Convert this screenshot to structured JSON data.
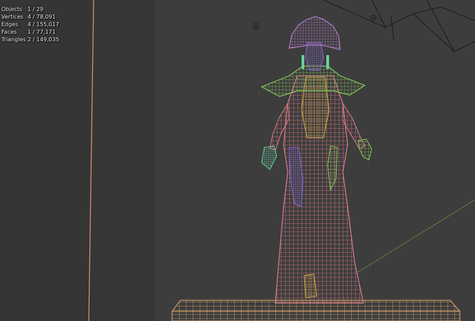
{
  "viewport": {
    "stats": [
      {
        "label": "Objects",
        "value": "1 / 29"
      },
      {
        "label": "Vertices",
        "value": "4 / 78,091"
      },
      {
        "label": "Edges",
        "value": "4 / 155,017"
      },
      {
        "label": "Faces",
        "value": "1 / 77,171"
      },
      {
        "label": "Triangles",
        "value": "2 / 149,035"
      }
    ]
  },
  "colors": {
    "background": "#3d3d3d",
    "side_panel": "#333333",
    "grid_line": "#393939",
    "x_axis": "#e8957e",
    "headdress": "#b27ac8",
    "face": "#8a6ad8",
    "dress": "#e07a88",
    "collar": "#8ac85a",
    "bodice": "#d8b24a",
    "hands": "#6ad0a0",
    "light": "#1a1a1a",
    "pedestal": "#e8b070"
  }
}
